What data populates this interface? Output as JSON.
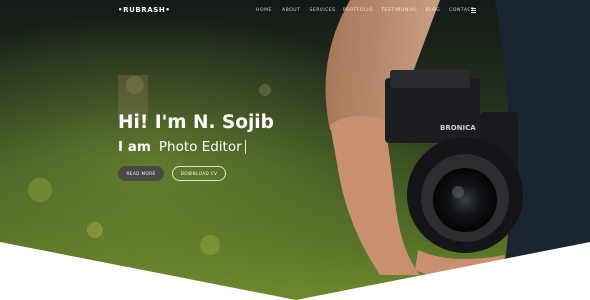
{
  "brand": {
    "name": "•RUBRASH•"
  },
  "nav": {
    "items": [
      "HOME",
      "ABOUT",
      "SERVICES",
      "PORTFOLIO",
      "TESTIMONIAL",
      "BLOG",
      "CONTACT"
    ]
  },
  "hero": {
    "headline": "Hi! I'm N. Sojib",
    "typed_prefix": "I am",
    "typed_word": "Photo Editor"
  },
  "buttons": {
    "read_more": "READ MORE",
    "download_cv": "DOWNLOAD CV"
  },
  "icons": {
    "menu": "menu-icon"
  }
}
